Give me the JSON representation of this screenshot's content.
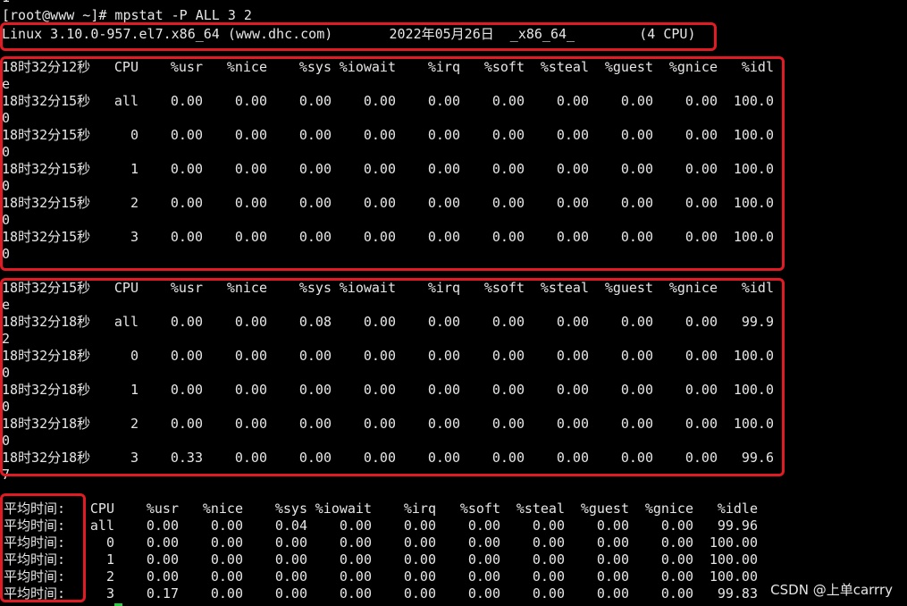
{
  "top_fragment": "1",
  "command_line": "[root@www ~]# mpstat -P ALL 3 2",
  "sysinfo": "Linux 3.10.0-957.el7.x86_64 (www.dhc.com)       2022年05月26日  _x86_64_        (4 CPU)",
  "headers": [
    "CPU",
    "%usr",
    "%nice",
    "%sys",
    "%iowait",
    "%irq",
    "%soft",
    "%steal",
    "%guest",
    "%gnice",
    "%idl"
  ],
  "headers_wrap": "e",
  "block1": {
    "header_time": "18时32分12秒",
    "rows": [
      {
        "time": "18时32分15秒",
        "cpu": "all",
        "vals": [
          "0.00",
          "0.00",
          "0.00",
          "0.00",
          "0.00",
          "0.00",
          "0.00",
          "0.00",
          "0.00",
          "100.0"
        ],
        "wrap": "0"
      },
      {
        "time": "18时32分15秒",
        "cpu": "0",
        "vals": [
          "0.00",
          "0.00",
          "0.00",
          "0.00",
          "0.00",
          "0.00",
          "0.00",
          "0.00",
          "0.00",
          "100.0"
        ],
        "wrap": "0"
      },
      {
        "time": "18时32分15秒",
        "cpu": "1",
        "vals": [
          "0.00",
          "0.00",
          "0.00",
          "0.00",
          "0.00",
          "0.00",
          "0.00",
          "0.00",
          "0.00",
          "100.0"
        ],
        "wrap": "0"
      },
      {
        "time": "18时32分15秒",
        "cpu": "2",
        "vals": [
          "0.00",
          "0.00",
          "0.00",
          "0.00",
          "0.00",
          "0.00",
          "0.00",
          "0.00",
          "0.00",
          "100.0"
        ],
        "wrap": "0"
      },
      {
        "time": "18时32分15秒",
        "cpu": "3",
        "vals": [
          "0.00",
          "0.00",
          "0.00",
          "0.00",
          "0.00",
          "0.00",
          "0.00",
          "0.00",
          "0.00",
          "100.0"
        ],
        "wrap": "0"
      }
    ]
  },
  "block2": {
    "header_time": "18时32分15秒",
    "rows": [
      {
        "time": "18时32分18秒",
        "cpu": "all",
        "vals": [
          "0.00",
          "0.00",
          "0.08",
          "0.00",
          "0.00",
          "0.00",
          "0.00",
          "0.00",
          "0.00",
          "99.9"
        ],
        "wrap": "2"
      },
      {
        "time": "18时32分18秒",
        "cpu": "0",
        "vals": [
          "0.00",
          "0.00",
          "0.00",
          "0.00",
          "0.00",
          "0.00",
          "0.00",
          "0.00",
          "0.00",
          "100.0"
        ],
        "wrap": "0"
      },
      {
        "time": "18时32分18秒",
        "cpu": "1",
        "vals": [
          "0.00",
          "0.00",
          "0.00",
          "0.00",
          "0.00",
          "0.00",
          "0.00",
          "0.00",
          "0.00",
          "100.0"
        ],
        "wrap": "0"
      },
      {
        "time": "18时32分18秒",
        "cpu": "2",
        "vals": [
          "0.00",
          "0.00",
          "0.00",
          "0.00",
          "0.00",
          "0.00",
          "0.00",
          "0.00",
          "0.00",
          "100.0"
        ],
        "wrap": "0"
      },
      {
        "time": "18时32分18秒",
        "cpu": "3",
        "vals": [
          "0.33",
          "0.00",
          "0.00",
          "0.00",
          "0.00",
          "0.00",
          "0.00",
          "0.00",
          "0.00",
          "99.6"
        ],
        "wrap": "7"
      }
    ]
  },
  "average": {
    "label": "平均时间:",
    "headers": [
      "CPU",
      "%usr",
      "%nice",
      "%sys",
      "%iowait",
      "%irq",
      "%soft",
      "%steal",
      "%guest",
      "%gnice",
      "%idle"
    ],
    "rows": [
      {
        "cpu": "all",
        "vals": [
          "0.00",
          "0.00",
          "0.04",
          "0.00",
          "0.00",
          "0.00",
          "0.00",
          "0.00",
          "0.00",
          "99.96"
        ]
      },
      {
        "cpu": "0",
        "vals": [
          "0.00",
          "0.00",
          "0.00",
          "0.00",
          "0.00",
          "0.00",
          "0.00",
          "0.00",
          "0.00",
          "100.00"
        ]
      },
      {
        "cpu": "1",
        "vals": [
          "0.00",
          "0.00",
          "0.00",
          "0.00",
          "0.00",
          "0.00",
          "0.00",
          "0.00",
          "0.00",
          "100.00"
        ]
      },
      {
        "cpu": "2",
        "vals": [
          "0.00",
          "0.00",
          "0.00",
          "0.00",
          "0.00",
          "0.00",
          "0.00",
          "0.00",
          "0.00",
          "100.00"
        ]
      },
      {
        "cpu": "3",
        "vals": [
          "0.17",
          "0.00",
          "0.00",
          "0.00",
          "0.00",
          "0.00",
          "0.00",
          "0.00",
          "0.00",
          "99.83"
        ]
      }
    ]
  },
  "watermark": "CSDN @上单carrry",
  "colors": {
    "background": "#000000",
    "text": "#e6e6e6",
    "highlight_box": "#e01b24",
    "cursor": "#27c93f"
  }
}
